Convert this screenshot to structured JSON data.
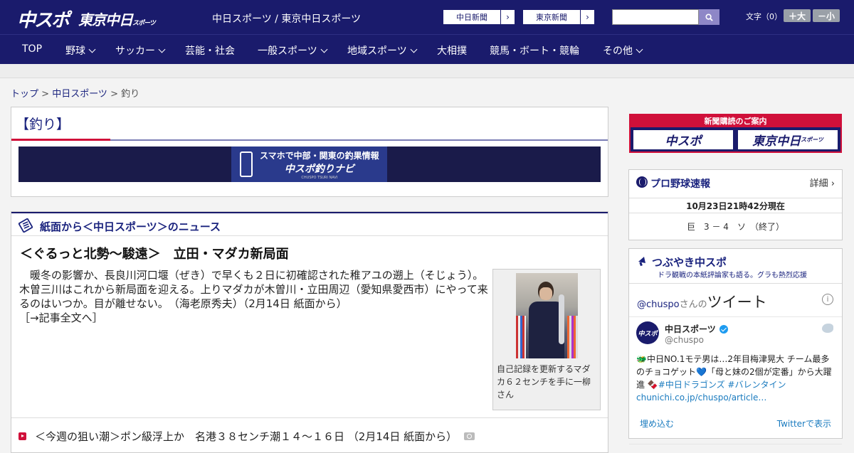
{
  "header": {
    "logo_chuspo": "中スポ",
    "logo_tokyo": "東京中日",
    "logo_tokyo_small": "スポーツ",
    "site_names": "中日スポーツ / 東京中日スポーツ",
    "btn_chunichi": "中日新聞",
    "btn_tokyo": "東京新聞",
    "arrow": "›",
    "fontsize_label": "文字（0）",
    "fs_large": "＋大",
    "fs_small": "－小"
  },
  "nav": {
    "items": [
      {
        "label": "TOP"
      },
      {
        "label": "野球"
      },
      {
        "label": "サッカー"
      },
      {
        "label": "芸能・社会"
      },
      {
        "label": "一般スポーツ"
      },
      {
        "label": "地域スポーツ"
      },
      {
        "label": "大相撲"
      },
      {
        "label": "競馬・ボート・競輪"
      },
      {
        "label": "その他"
      }
    ]
  },
  "breadcrumb": {
    "top": "トップ",
    "sep": " > ",
    "chuspo": "中日スポーツ",
    "current": "釣り"
  },
  "page": {
    "title": "【釣り】"
  },
  "banner": {
    "line1": "スマホで中部・関東の釣果情報",
    "line2": "中スポ釣りナビ",
    "line3": "CHUSPO TSURI NAVI"
  },
  "news": {
    "section_title": "紙面から＜中日スポーツ＞のニュース",
    "article_title": "＜ぐるっと北勢～駿遠＞　立田・マダカ新局面",
    "article_body": "　暖冬の影響か、長良川河口堰（ぜき）で早くも２日に初確認された稚アユの遡上（そじょう）。木曽三川はこれから新局面を迎える。上りマダカが木曽川・立田周辺（愛知県愛西市）にやって来るのはいつか。目が離せない。　（海老原秀夫）（2月14日 紙面から）",
    "article_more": "［→記事全文へ］",
    "photo_caption": "自己記録を更新するマダカ６２センチを手に一柳さん",
    "list_item": "＜今週の狙い潮＞ポン級浮上か　名港３８センチ潮１４～１６日 （2月14日 紙面から）"
  },
  "sidebar": {
    "subs_header": "新聞購読のご案内",
    "subs_chuspo": "中スポ",
    "subs_tokyo": "東京中日",
    "subs_tokyo_small": "スポーツ",
    "score_title": "プロ野球速報",
    "score_detail": "詳細",
    "score_time": "10月23日21時42分現在",
    "score_game": "巨　3 － 4　ソ　（終了）",
    "tweet_title": "つぶやき中スポ",
    "tweet_sub": "ドラ観戦の本紙評論家も語る。グラも熱烈応援",
    "tw_handle_prefix": "@chuspo",
    "tw_san": "さんの",
    "tw_tweet": "ツイート",
    "tw_info": "i",
    "tw_avatar": "中スポ",
    "tw_name": "中日スポーツ",
    "tw_account": "@chuspo",
    "tw_text_1": "🐲中日NO.1モテ男は…2年目梅津晃大 チーム最多のチョコゲット💙「母と妹の2個が定番」から大躍進 🍫",
    "tw_hashtags": "#中日ドラゴンズ #バレンタイン",
    "tw_link": "chunichi.co.jp/chuspo/article…",
    "tw_embed": "埋め込む",
    "tw_view": "Twitterで表示"
  },
  "colors": {
    "brand_navy": "#1a1b6c",
    "accent_red": "#d0103a",
    "link_blue": "#1a237e",
    "twitter_blue": "#1a7bbf"
  },
  "icons": [
    "search-icon",
    "chevron-down-icon",
    "newspaper-icon",
    "baseball-icon",
    "megaphone-icon",
    "info-icon",
    "verified-icon",
    "twitter-bird-icon",
    "video-icon",
    "camera-icon",
    "smartphone-icon"
  ]
}
